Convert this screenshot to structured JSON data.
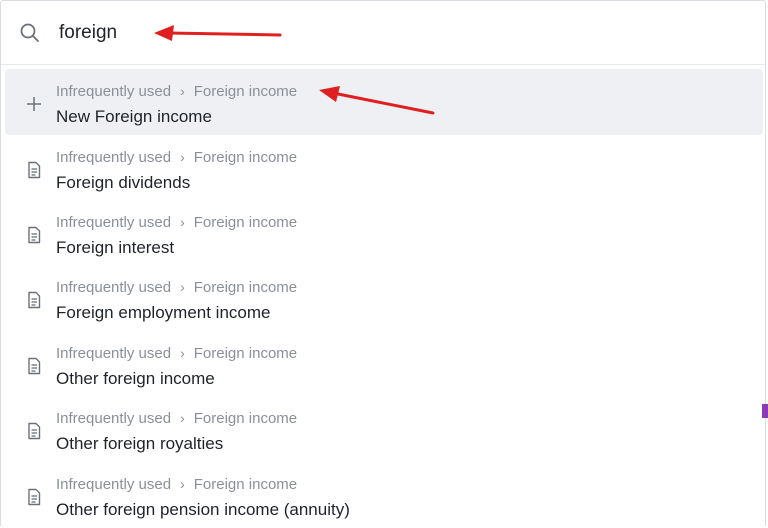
{
  "search": {
    "value": "foreign"
  },
  "results": [
    {
      "breadcrumb_parent": "Infrequently used",
      "breadcrumb_child": "Foreign income",
      "title": "New Foreign income",
      "icon": "plus-icon",
      "active": true
    },
    {
      "breadcrumb_parent": "Infrequently used",
      "breadcrumb_child": "Foreign income",
      "title": "Foreign dividends",
      "icon": "document-icon"
    },
    {
      "breadcrumb_parent": "Infrequently used",
      "breadcrumb_child": "Foreign income",
      "title": "Foreign interest",
      "icon": "document-icon"
    },
    {
      "breadcrumb_parent": "Infrequently used",
      "breadcrumb_child": "Foreign income",
      "title": "Foreign employment income",
      "icon": "document-icon"
    },
    {
      "breadcrumb_parent": "Infrequently used",
      "breadcrumb_child": "Foreign income",
      "title": "Other foreign income",
      "icon": "document-icon"
    },
    {
      "breadcrumb_parent": "Infrequently used",
      "breadcrumb_child": "Foreign income",
      "title": "Other foreign royalties",
      "icon": "document-icon"
    },
    {
      "breadcrumb_parent": "Infrequently used",
      "breadcrumb_child": "Foreign income",
      "title": "Other foreign pension income (annuity)",
      "icon": "document-icon"
    }
  ],
  "annotation_color": "#e02020"
}
